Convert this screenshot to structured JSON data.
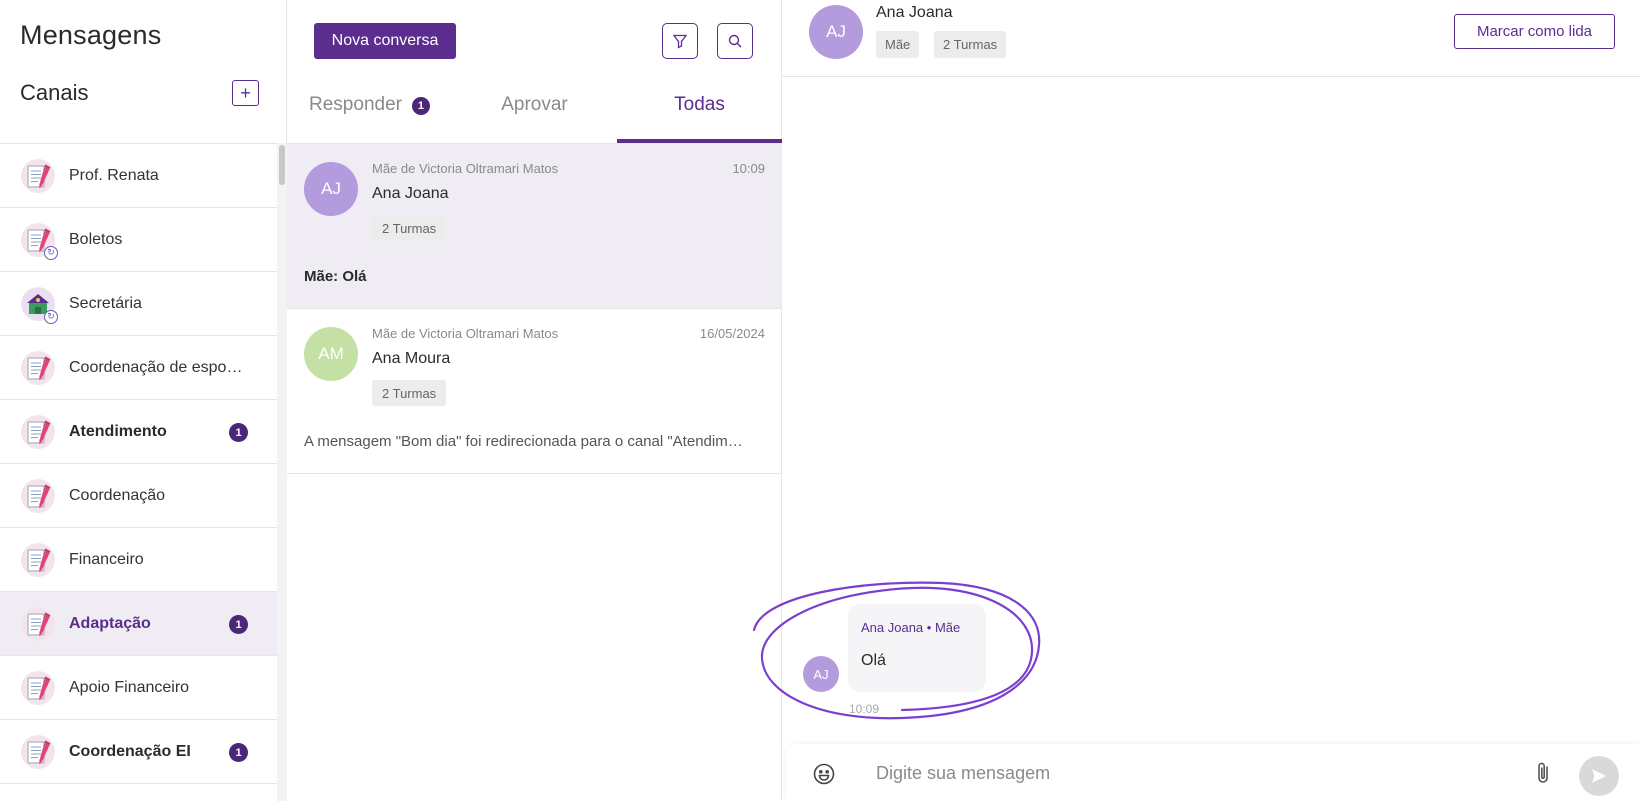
{
  "sidebar": {
    "title": "Mensagens",
    "channels_title": "Canais",
    "add_channel_icon": "plus-icon",
    "channels": [
      {
        "label": "Prof. Renata",
        "icon": "notebook-pencil-icon",
        "sync": false,
        "badge": "",
        "unread": false,
        "active": false
      },
      {
        "label": "Boletos",
        "icon": "notebook-pencil-icon",
        "sync": true,
        "badge": "",
        "unread": false,
        "active": false
      },
      {
        "label": "Secretária",
        "icon": "school-building-icon",
        "sync": true,
        "badge": "",
        "unread": false,
        "active": false
      },
      {
        "label": "Coordenação de esport…",
        "icon": "notebook-pencil-icon",
        "sync": false,
        "badge": "",
        "unread": false,
        "active": false
      },
      {
        "label": "Atendimento",
        "icon": "notebook-pencil-icon",
        "sync": false,
        "badge": "1",
        "unread": true,
        "active": false
      },
      {
        "label": "Coordenação",
        "icon": "notebook-pencil-icon",
        "sync": false,
        "badge": "",
        "unread": false,
        "active": false
      },
      {
        "label": "Financeiro",
        "icon": "notebook-pencil-icon",
        "sync": false,
        "badge": "",
        "unread": false,
        "active": false
      },
      {
        "label": "Adaptação",
        "icon": "notebook-pencil-icon",
        "sync": false,
        "badge": "1",
        "unread": true,
        "active": true
      },
      {
        "label": "Apoio Financeiro",
        "icon": "notebook-pencil-icon",
        "sync": false,
        "badge": "",
        "unread": false,
        "active": false
      },
      {
        "label": "Coordenação EI",
        "icon": "notebook-pencil-icon",
        "sync": false,
        "badge": "1",
        "unread": true,
        "active": false
      }
    ]
  },
  "conversations": {
    "new_button": "Nova conversa",
    "filter_icon": "filter-icon",
    "search_icon": "search-icon",
    "tabs": [
      {
        "label": "Responder",
        "badge": "1",
        "active": false
      },
      {
        "label": "Aprovar",
        "badge": "",
        "active": false
      },
      {
        "label": "Todas",
        "badge": "",
        "active": true
      }
    ],
    "items": [
      {
        "initials": "AJ",
        "avatar_color": "#b39bde",
        "subtitle": "Mãe de Victoria Oltramari Matos",
        "time": "10:09",
        "name": "Ana Joana",
        "tag": "2 Turmas",
        "preview": "Mãe: Olá",
        "selected": true
      },
      {
        "initials": "AM",
        "avatar_color": "#c5e0a5",
        "subtitle": "Mãe de Victoria Oltramari Matos",
        "time": "16/05/2024",
        "name": "Ana Moura",
        "tag": "2 Turmas",
        "preview": "A mensagem \"Bom dia\" foi redirecionada para o canal \"Atendim…",
        "selected": false
      }
    ]
  },
  "chat": {
    "header": {
      "initials": "AJ",
      "name": "Ana Joana",
      "tags": [
        "Mãe",
        "2 Turmas"
      ],
      "mark_read": "Marcar como lida"
    },
    "messages": [
      {
        "initials": "AJ",
        "author": "Ana Joana • Mãe",
        "text": "Olá",
        "time": "10:09"
      }
    ],
    "composer": {
      "placeholder": "Digite sua mensagem",
      "emoji_icon": "emoji-icon",
      "attach_icon": "paperclip-icon",
      "send_icon": "send-icon"
    }
  },
  "colors": {
    "accent": "#5b2d8e",
    "badge": "#4a2778",
    "selected_bg": "#efecf4",
    "annotation": "#7b3fd0"
  }
}
